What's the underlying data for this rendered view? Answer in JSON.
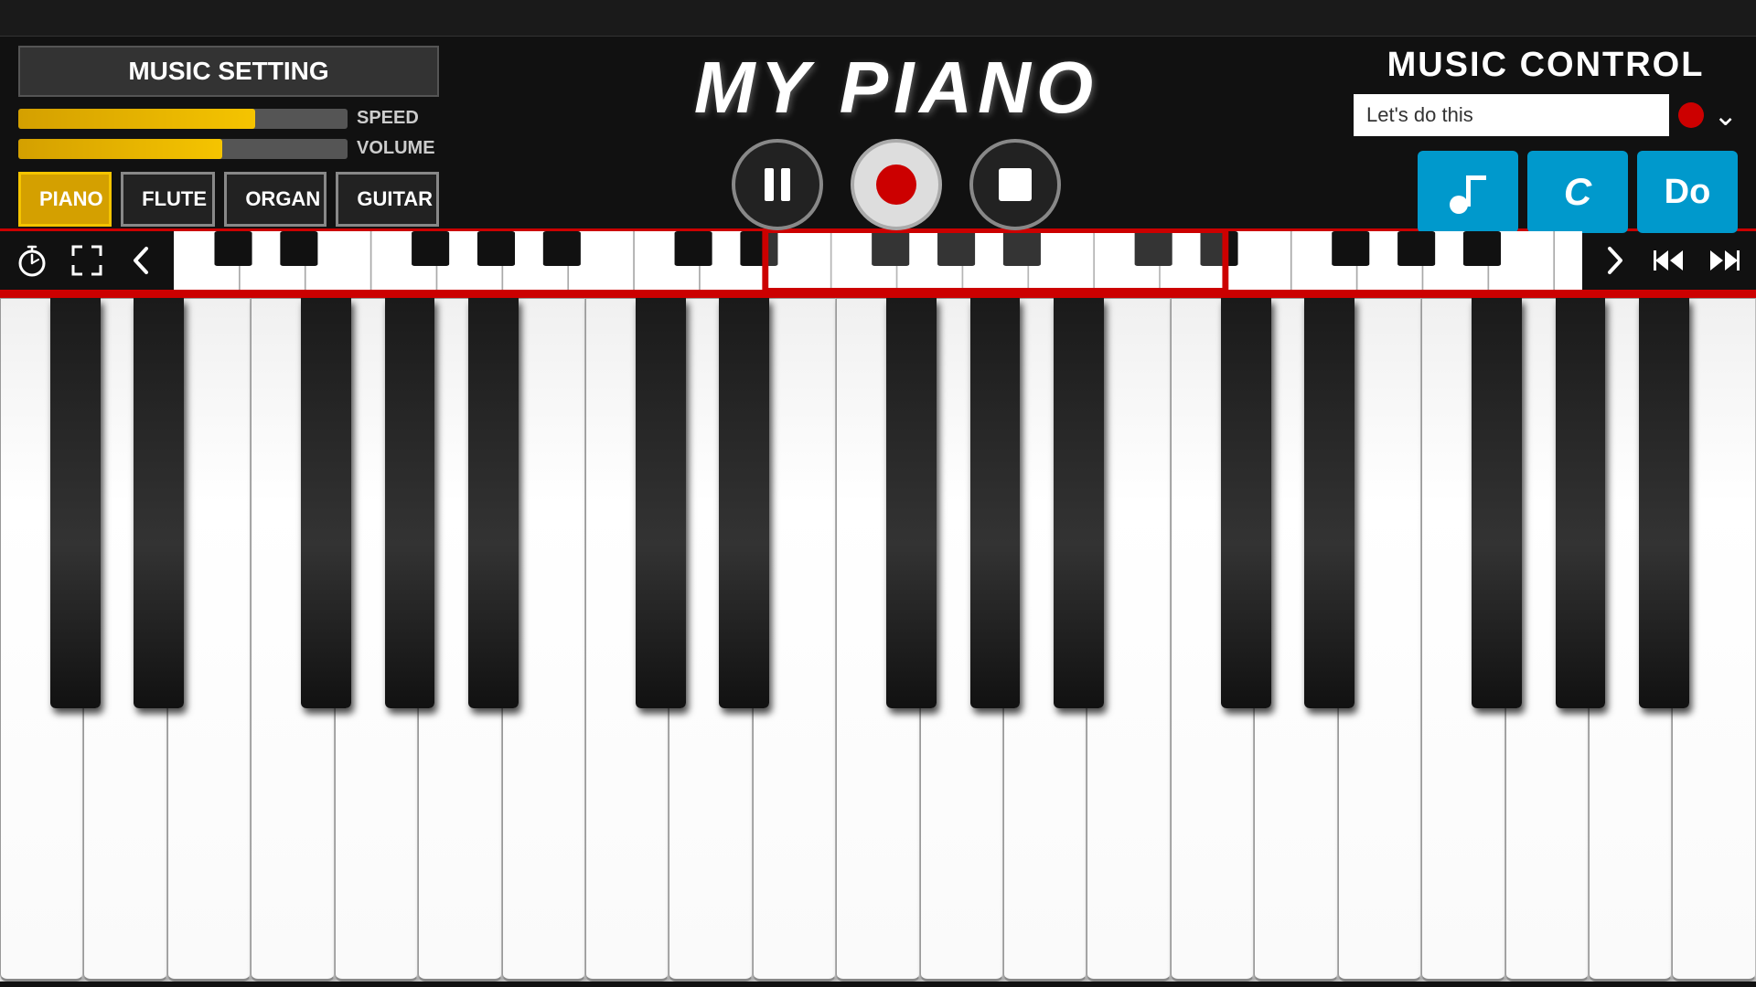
{
  "app": {
    "title": "MY PIANO",
    "topBar": ""
  },
  "musicSetting": {
    "title": "MUSIC SETTING",
    "speedLabel": "SPEED",
    "volumeLabel": "VOLUME",
    "speedPercent": 72,
    "volumePercent": 62,
    "instruments": [
      "PIANO",
      "FLUTE",
      "ORGAN",
      "GUITAR"
    ],
    "activeInstrument": "PIANO"
  },
  "transport": {
    "pauseLabel": "pause",
    "recordLabel": "record",
    "stopLabel": "stop"
  },
  "musicControl": {
    "title": "MUSIC CONTROL",
    "songName": "Let's do this",
    "chevronLabel": "▾",
    "modeBtns": [
      {
        "label": "🎵",
        "name": "music-mode"
      },
      {
        "label": "C",
        "name": "c-mode"
      },
      {
        "label": "Do",
        "name": "do-mode"
      }
    ]
  },
  "navBar": {
    "timerIcon": "⏱",
    "fullscreenIcon": "⛶",
    "prevIcon": "❮",
    "nextIcon": "❯",
    "rewindIcon": "⏮",
    "fastForwardIcon": "⏭"
  }
}
